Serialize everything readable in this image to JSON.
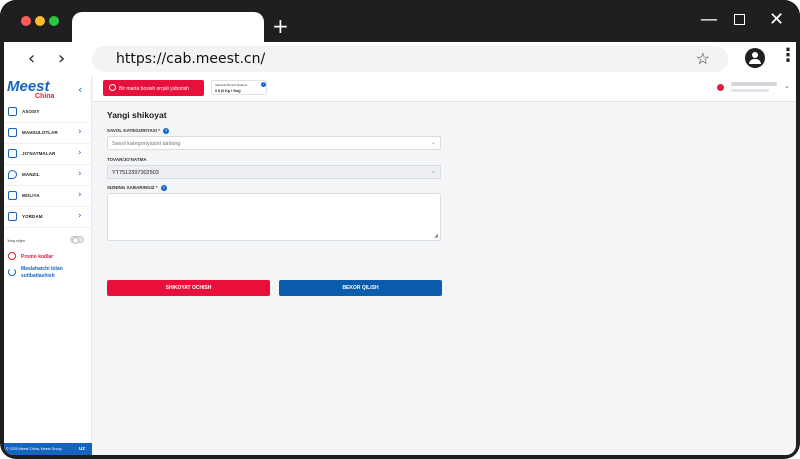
{
  "browser": {
    "url": "https://cab.meest.cn/",
    "new_tab": "+",
    "back": "‹",
    "forward": "›"
  },
  "logo": {
    "main": "Meest",
    "sub": "China"
  },
  "sidebar": {
    "collapse": "‹",
    "items": [
      {
        "label": "ASOSIY",
        "icon": "home-icon"
      },
      {
        "label": "MAHSULOTLAR",
        "icon": "bag-icon"
      },
      {
        "label": "JO'NATMALAR",
        "icon": "box-icon"
      },
      {
        "label": "MANZIL",
        "icon": "location-icon"
      },
      {
        "label": "MOLIYA",
        "icon": "wallet-icon"
      },
      {
        "label": "YORDAM",
        "icon": "chat-icon"
      }
    ],
    "dark_mode": "Yorq rejim",
    "promo": "Promo kodlar",
    "chat": "Maslahatchi bilan suhbatlashish",
    "footer": "© 2025 Meest China, Meest Group",
    "lang": "UZ"
  },
  "header": {
    "oneclick": "Bir marta bosish orqali yuborish",
    "balance_label": "Vaksudb Bonish Balansi",
    "balance_value": "0 $ (0 Kg / Yoq)",
    "balance_help": "?"
  },
  "form": {
    "title": "Yangi shikoyat",
    "category_label": "SAVOL KATEGORIYASI *",
    "category_placeholder": "Savol kategoriyasini tanlang",
    "tracking_label": "TOVAR/JO'NATMA",
    "tracking_value": "YT7512397302503",
    "message_label": "SIZNING XABARINGIZ *",
    "help": "?",
    "submit": "SHIKOYAT OCHISH",
    "cancel": "BEKOR QILISH"
  },
  "colors": {
    "brand_blue": "#1565c0",
    "brand_red": "#e8103b"
  }
}
